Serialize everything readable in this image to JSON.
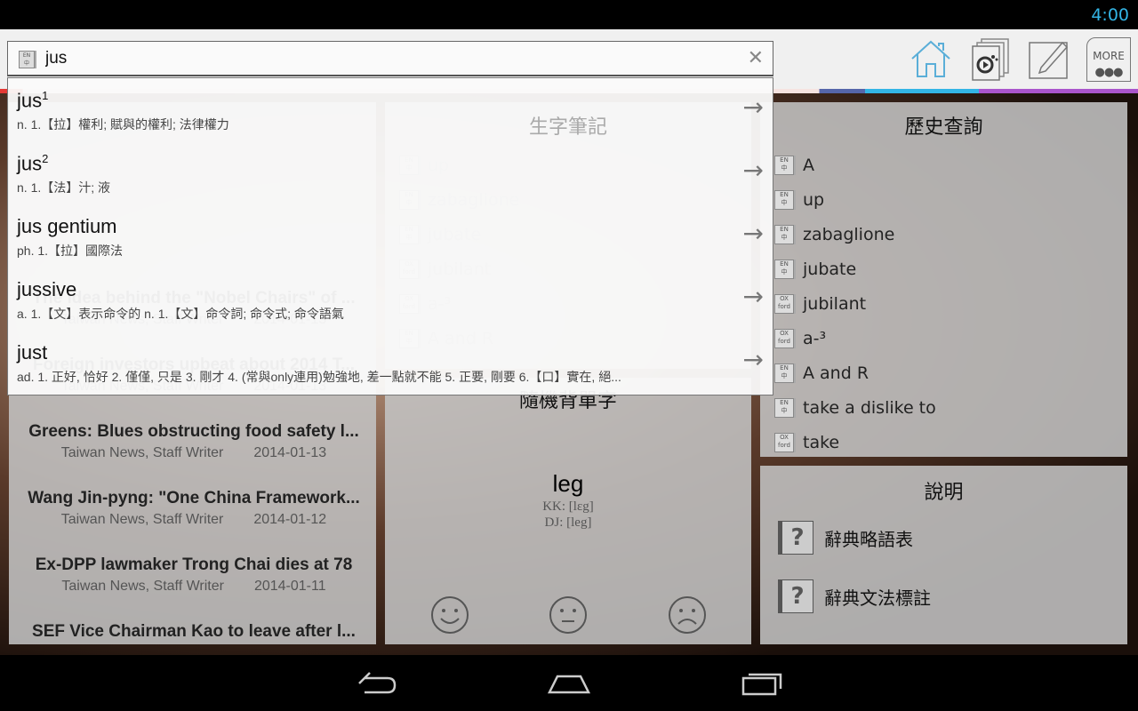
{
  "status": {
    "clock": "4:00"
  },
  "search": {
    "value": "jus",
    "dict_icon": "en-zh-dict-icon",
    "clear_icon": "close-icon"
  },
  "toolbar": {
    "home": "home-icon",
    "flashcards": "flashcards-icon",
    "notes": "edit-icon",
    "more_label": "MORE"
  },
  "colors": {
    "accent": "#33b5e5",
    "home": "#5aaed8"
  },
  "suggestions": [
    {
      "word": "jus",
      "sup": "1",
      "def": "n. 1.【拉】權利; 賦與的權利; 法律權力"
    },
    {
      "word": "jus",
      "sup": "2",
      "def": "n. 1.【法】汁; 液"
    },
    {
      "word": "jus gentium",
      "sup": "",
      "def": "ph. 1.【拉】國際法"
    },
    {
      "word": "jussive",
      "sup": "",
      "def": "a. 1.【文】表示命令的  n. 1.【文】命令詞; 命令式; 命令語氣"
    },
    {
      "word": "just",
      "sup": "",
      "def": "ad. 1. 正好, 恰好  2. 僅僅, 只是  3. 剛才  4. (常與only連用)勉強地, 差一點就不能  5. 正要, 剛要  6.【口】實在, 絕..."
    }
  ],
  "news": {
    "items": [
      {
        "title": "The idea behind the \"Nobel Chairs\" of ...",
        "source": "Taiwan News, Staff Writer",
        "date": "2014-01-13"
      },
      {
        "title": "Foreign investors upbeat about 2014 T...",
        "source": "Taiwan News, Staff Writer",
        "date": "2014-01-13"
      },
      {
        "title": "Greens: Blues obstructing food safety l...",
        "source": "Taiwan News, Staff Writer",
        "date": "2014-01-13"
      },
      {
        "title": "Wang Jin-pyng: \"One China Framework...",
        "source": "Taiwan News, Staff Writer",
        "date": "2014-01-12"
      },
      {
        "title": "Ex-DPP lawmaker Trong Chai dies at 78",
        "source": "Taiwan News, Staff Writer",
        "date": "2014-01-11"
      },
      {
        "title": "SEF Vice Chairman Kao to leave after l...",
        "source": "",
        "date": ""
      }
    ]
  },
  "vocab": {
    "title": "生字筆記",
    "items": [
      {
        "word": "up",
        "dict": "EN"
      },
      {
        "word": "zabaglione",
        "dict": "EN"
      },
      {
        "word": "jubate",
        "dict": "EN"
      },
      {
        "word": "jubilant",
        "dict": "OX"
      },
      {
        "word": "a-³",
        "dict": "OX"
      },
      {
        "word": "A and R",
        "dict": "EN"
      }
    ]
  },
  "random": {
    "title": "隨機背單字",
    "word": "leg",
    "kk": "KK:  [lɛg]",
    "dj": "DJ:  [leg]",
    "faces": [
      "smile-icon",
      "neutral-icon",
      "frown-icon"
    ]
  },
  "history": {
    "title": "歷史查詢",
    "items": [
      {
        "word": "A",
        "dict": "EN"
      },
      {
        "word": "up",
        "dict": "EN"
      },
      {
        "word": "zabaglione",
        "dict": "EN"
      },
      {
        "word": "jubate",
        "dict": "EN"
      },
      {
        "word": "jubilant",
        "dict": "OX"
      },
      {
        "word": "a-³",
        "dict": "OX"
      },
      {
        "word": "A and R",
        "dict": "EN"
      },
      {
        "word": "take a dislike to",
        "dict": "EN"
      },
      {
        "word": "take",
        "dict": "OX"
      }
    ]
  },
  "help": {
    "title": "說明",
    "items": [
      {
        "label": "辭典略語表"
      },
      {
        "label": "辭典文法標註"
      }
    ]
  },
  "nav": {
    "back": "back-icon",
    "home": "home-icon",
    "recents": "recents-icon"
  }
}
